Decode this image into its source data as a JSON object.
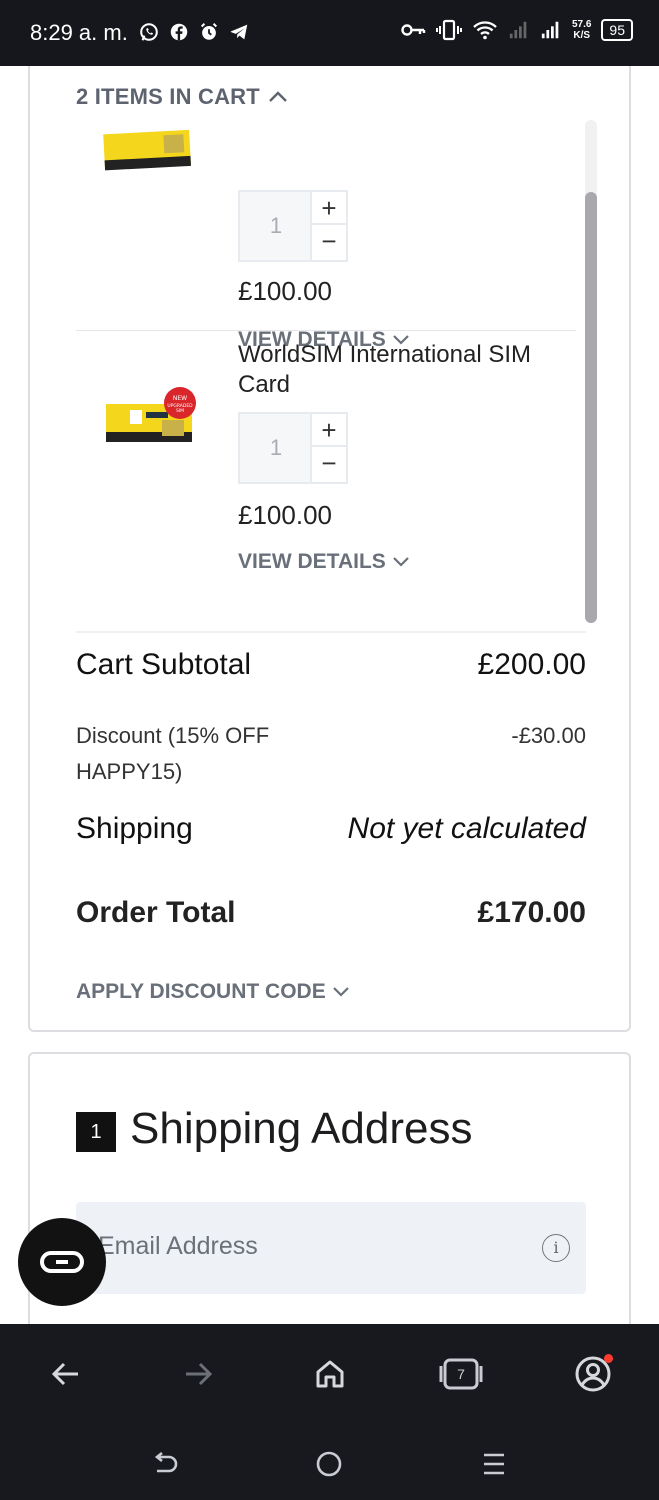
{
  "status_bar": {
    "time": "8:29 a. m.",
    "net_speed_value": "57.6",
    "net_speed_unit": "K/S",
    "battery": "95"
  },
  "cart": {
    "header": "2 ITEMS IN CART",
    "items": [
      {
        "name": "",
        "qty": "1",
        "price": "£100.00",
        "details_label": "VIEW DETAILS"
      },
      {
        "name": "WorldSIM International SIM Card",
        "qty": "1",
        "price": "£100.00",
        "details_label": "VIEW DETAILS",
        "badge": "NEW UPGRADED SIM"
      }
    ],
    "subtotal_label": "Cart Subtotal",
    "subtotal_value": "£200.00",
    "discount_label": "Discount (15% OFF HAPPY15)",
    "discount_value": "-£30.00",
    "shipping_label": "Shipping",
    "shipping_value": "Not yet calculated",
    "total_label": "Order Total",
    "total_value": "£170.00",
    "apply_code_label": "APPLY DISCOUNT CODE"
  },
  "shipping_section": {
    "step": "1",
    "title": "Shipping Address",
    "email_placeholder": "Email Address"
  },
  "browser_nav": {
    "tabs_count": "7"
  },
  "colors": {
    "status_bg": "#15171c",
    "nav_bg": "#17191e",
    "muted_text": "#6a707a",
    "field_bg": "#eef2f6",
    "badge_red": "#d8262b",
    "sim_yellow": "#f4d71c"
  }
}
